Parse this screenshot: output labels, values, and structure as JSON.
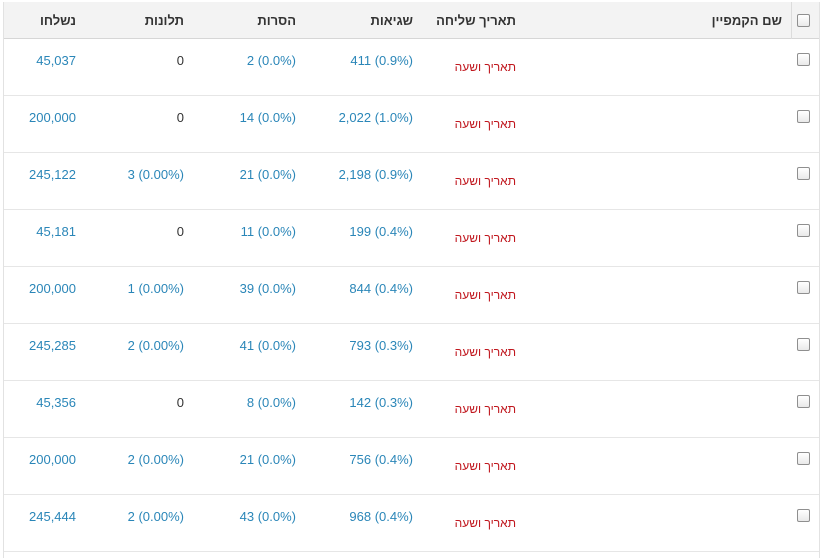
{
  "headers": {
    "sent": "נשלחו",
    "complaints": "תלונות",
    "unsubscribes": "הסרות",
    "errors": "שגיאות",
    "send_date": "תאריך שליחה",
    "campaign_name": "שם הקמפיין"
  },
  "colors": {
    "link": "#2a86b8",
    "date_text": "#c0161d",
    "header_bg": "#f3f3f3"
  },
  "rows": [
    {
      "sent": "45,037",
      "complaints": "0",
      "unsubscribes": "2 (0.0%)",
      "errors": "411 (0.9%)",
      "send_date": "תאריך ושעה"
    },
    {
      "sent": "200,000",
      "complaints": "0",
      "unsubscribes": "14 (0.0%)",
      "errors": "2,022 (1.0%)",
      "send_date": "תאריך ושעה"
    },
    {
      "sent": "245,122",
      "complaints": "3 (0.00%)",
      "unsubscribes": "21 (0.0%)",
      "errors": "2,198 (0.9%)",
      "send_date": "תאריך ושעה"
    },
    {
      "sent": "45,181",
      "complaints": "0",
      "unsubscribes": "11 (0.0%)",
      "errors": "199 (0.4%)",
      "send_date": "תאריך ושעה"
    },
    {
      "sent": "200,000",
      "complaints": "1 (0.00%)",
      "unsubscribes": "39 (0.0%)",
      "errors": "844 (0.4%)",
      "send_date": "תאריך ושעה"
    },
    {
      "sent": "245,285",
      "complaints": "2 (0.00%)",
      "unsubscribes": "41 (0.0%)",
      "errors": "793 (0.3%)",
      "send_date": "תאריך ושעה"
    },
    {
      "sent": "45,356",
      "complaints": "0",
      "unsubscribes": "8 (0.0%)",
      "errors": "142 (0.3%)",
      "send_date": "תאריך ושעה"
    },
    {
      "sent": "200,000",
      "complaints": "2 (0.00%)",
      "unsubscribes": "21 (0.0%)",
      "errors": "756 (0.4%)",
      "send_date": "תאריך ושעה"
    },
    {
      "sent": "245,444",
      "complaints": "2 (0.00%)",
      "unsubscribes": "43 (0.0%)",
      "errors": "968 (0.4%)",
      "send_date": "תאריך ושעה"
    }
  ]
}
